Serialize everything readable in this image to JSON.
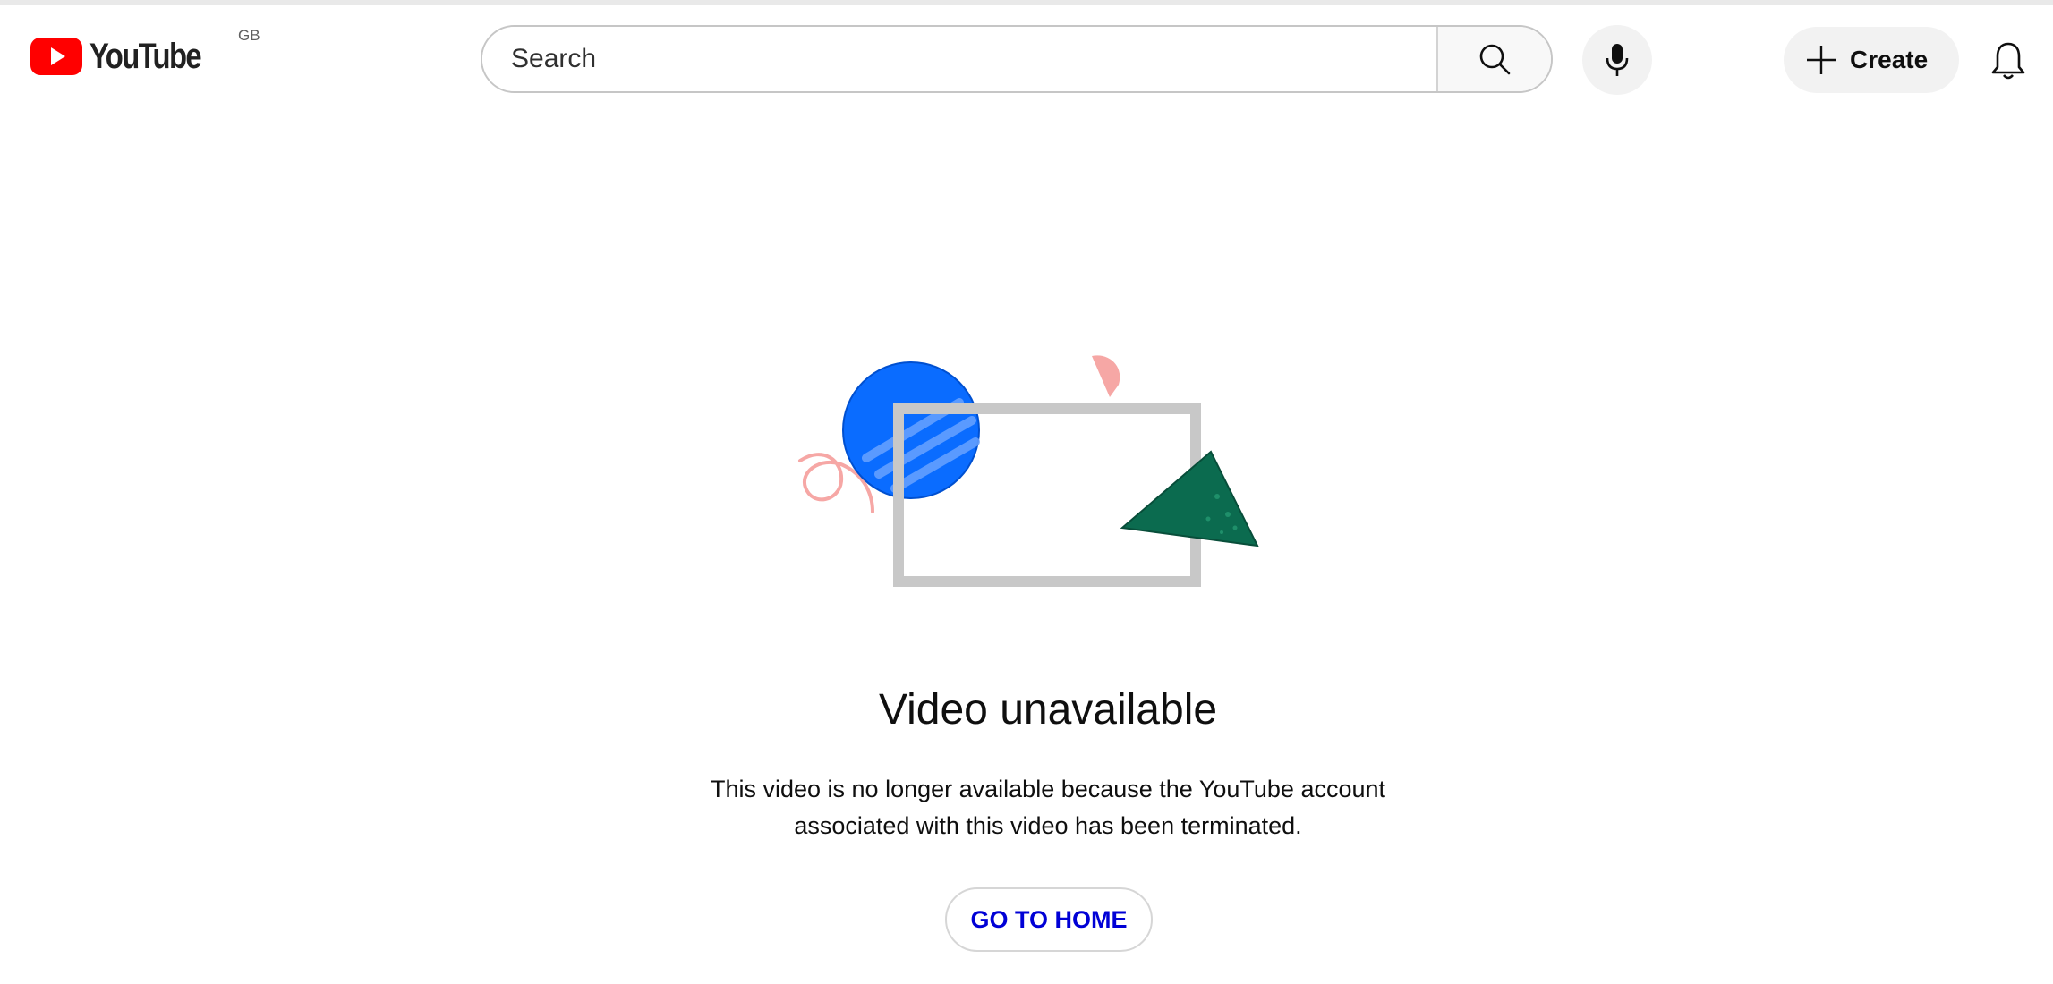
{
  "header": {
    "logo_text": "YouTube",
    "region": "GB",
    "search_placeholder": "Search",
    "create_label": "Create"
  },
  "error": {
    "title": "Video unavailable",
    "message_line1": "This video is no longer available because the YouTube account",
    "message_line2": "associated with this video has been terminated.",
    "home_button_label": "GO TO HOME"
  },
  "colors": {
    "brand_red": "#ff0000",
    "link_blue": "#0000d6",
    "illustration_blue": "#0a6cff",
    "illustration_green": "#0b6b4f",
    "illustration_pink": "#f6a7a5",
    "frame_gray": "#c8c8c8"
  },
  "icons": [
    "youtube-logo-icon",
    "search-icon",
    "microphone-icon",
    "plus-icon",
    "bell-icon"
  ]
}
